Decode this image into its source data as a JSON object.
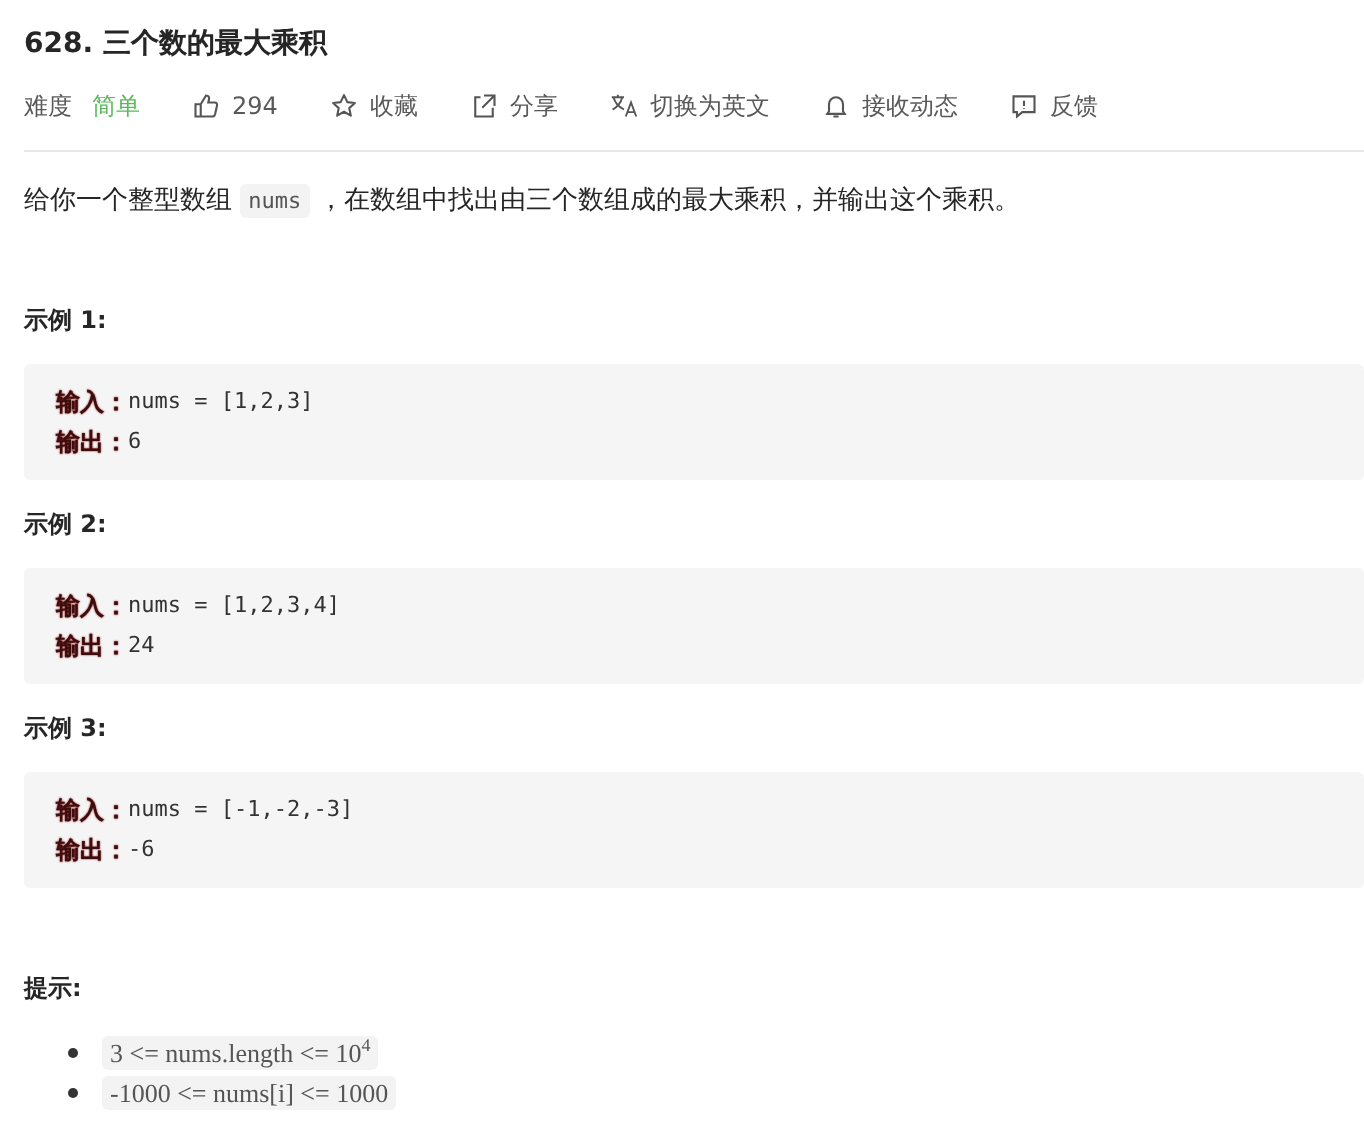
{
  "title": "628. 三个数的最大乘积",
  "meta": {
    "difficulty_label": "难度",
    "difficulty": "简单",
    "actions": [
      {
        "kind": "like",
        "label": "294"
      },
      {
        "kind": "star",
        "label": "收藏"
      },
      {
        "kind": "share",
        "label": "分享"
      },
      {
        "kind": "translate",
        "label": "切换为英文"
      },
      {
        "kind": "bell",
        "label": "接收动态"
      },
      {
        "kind": "feedback",
        "label": "反馈"
      }
    ]
  },
  "description": [
    {
      "kind": "text",
      "text": "给你一个整型数组 "
    },
    {
      "kind": "code",
      "text": "nums"
    },
    {
      "kind": "text",
      "text": " ，在数组中找出由三个数组成的最大乘积，并输出这个乘积。"
    }
  ],
  "examples": [
    {
      "heading": "示例 1:",
      "input_label": "输入：",
      "input": "nums = [1,2,3]",
      "output_label": "输出：",
      "output": "6"
    },
    {
      "heading": "示例 2:",
      "input_label": "输入：",
      "input": "nums = [1,2,3,4]",
      "output_label": "输出：",
      "output": "24"
    },
    {
      "heading": "示例 3:",
      "input_label": "输入：",
      "input": "nums = [-1,-2,-3]",
      "output_label": "输出：",
      "output": "-6"
    }
  ],
  "hints_heading": "提示:",
  "hints": [
    "3 <= nums.length <=  10$^{4}$",
    "-1000 <= nums[i] <= 1000"
  ]
}
